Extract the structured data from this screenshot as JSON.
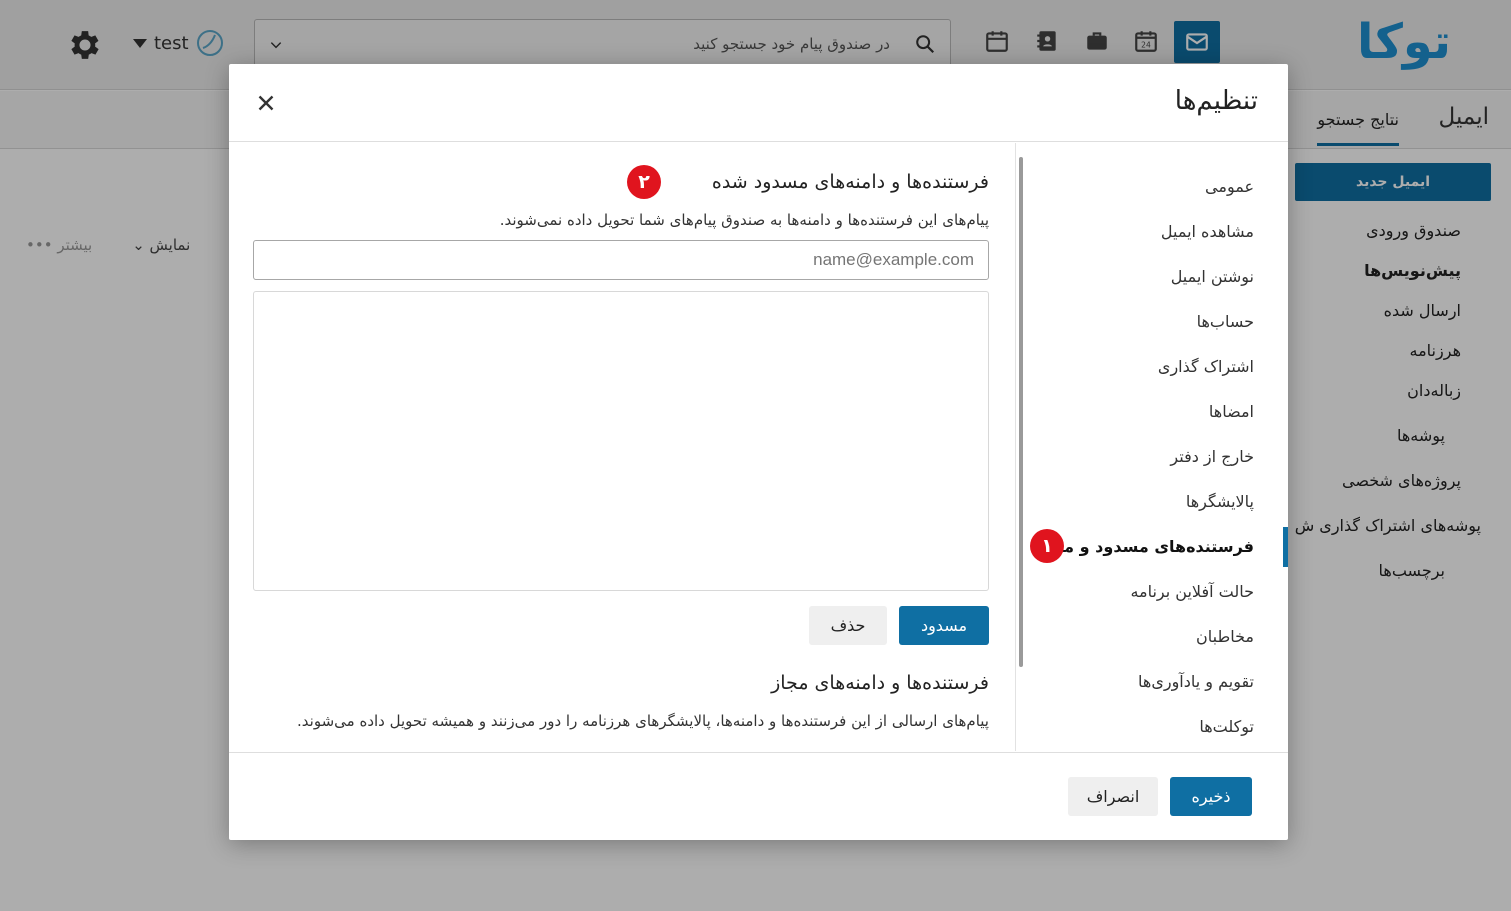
{
  "app": {
    "logo_text": "توکا",
    "search_placeholder": "در صندوق پیام خود جستجو کنید",
    "account_name": "test",
    "tabs": {
      "email": "ایمیل",
      "search_results": "نتایج جستجو"
    },
    "new_email_label": "ایمیل جدید",
    "folders": [
      "صندوق ورودی",
      "پیش‌نویس‌ها",
      "ارسال شده",
      "هرزنامه",
      "زباله‌دان",
      "پوشه‌ها",
      "پروژه‌های شخصی",
      "پوشه‌های اشتراک گذاری ش",
      "برچسب‌ها"
    ],
    "toolbar": {
      "view_label": "نمایش",
      "more_label": "بیشتر"
    },
    "accent_color": "#0f6fa3"
  },
  "modal": {
    "title": "تنظیم‌ها",
    "nav_items": [
      "عمومی",
      "مشاهده ایمیل",
      "نوشتن ایمیل",
      "حساب‌ها",
      "اشتراک گذاری",
      "امضاها",
      "خارج از دفتر",
      "پالایشگرها",
      "فرستنده‌های مسدود و مجاز",
      "حالت آفلاین برنامه",
      "مخاطبان",
      "تقویم و یادآوری‌ها",
      "توکلت‌ها"
    ],
    "active_nav": "فرستنده‌های مسدود و مجاز",
    "badges": {
      "one": "۱",
      "two": "۲"
    },
    "badge_color": "#e0141e",
    "blocked": {
      "title": "فرستنده‌ها و دامنه‌های مسدود شده",
      "description": "پیام‌های این فرستنده‌ها و دامنه‌ها به صندوق پیام‌های شما تحویل داده نمی‌شوند.",
      "input_placeholder": "name@example.com",
      "block_button": "مسدود",
      "delete_button": "حذف"
    },
    "allowed": {
      "title": "فرستنده‌ها و دامنه‌های مجاز",
      "description": "پیام‌های ارسالی از این فرستنده‌ها و دامنه‌ها، پالایشگرهای هرزنامه را دور می‌زنند و همیشه تحویل داده می‌شوند."
    },
    "footer": {
      "save_button": "ذخیره",
      "cancel_button": "انصراف"
    }
  }
}
